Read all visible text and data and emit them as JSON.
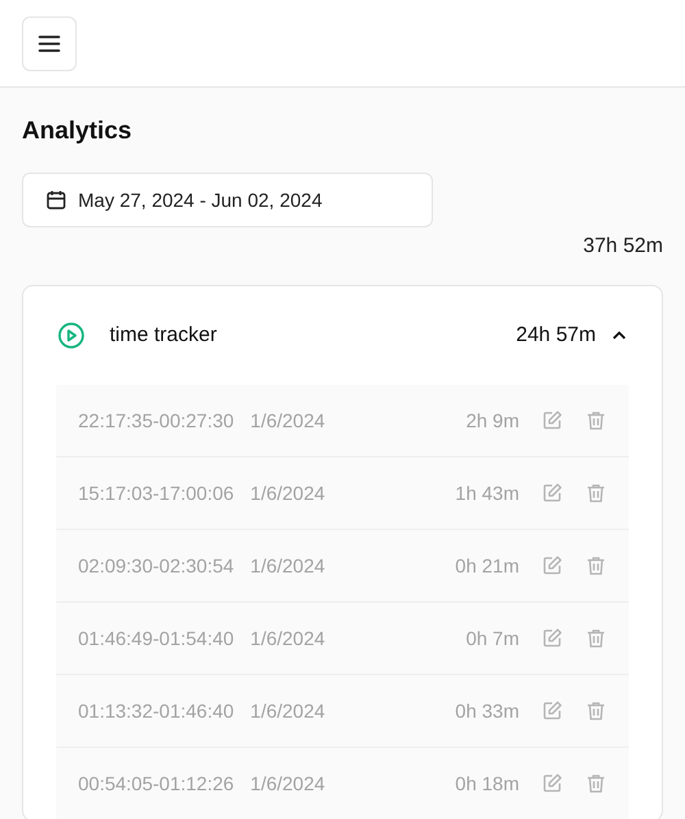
{
  "page_title": "Analytics",
  "date_range": "May 27, 2024 - Jun 02, 2024",
  "total": "37h 52m",
  "project": {
    "name": "time tracker",
    "total": "24h 57m",
    "expanded": true,
    "entries": [
      {
        "time": "22:17:35-00:27:30",
        "date": "1/6/2024",
        "duration": "2h 9m"
      },
      {
        "time": "15:17:03-17:00:06",
        "date": "1/6/2024",
        "duration": "1h 43m"
      },
      {
        "time": "02:09:30-02:30:54",
        "date": "1/6/2024",
        "duration": "0h 21m"
      },
      {
        "time": "01:46:49-01:54:40",
        "date": "1/6/2024",
        "duration": "0h 7m"
      },
      {
        "time": "01:13:32-01:46:40",
        "date": "1/6/2024",
        "duration": "0h 33m"
      },
      {
        "time": "00:54:05-01:12:26",
        "date": "1/6/2024",
        "duration": "0h 18m"
      }
    ]
  }
}
